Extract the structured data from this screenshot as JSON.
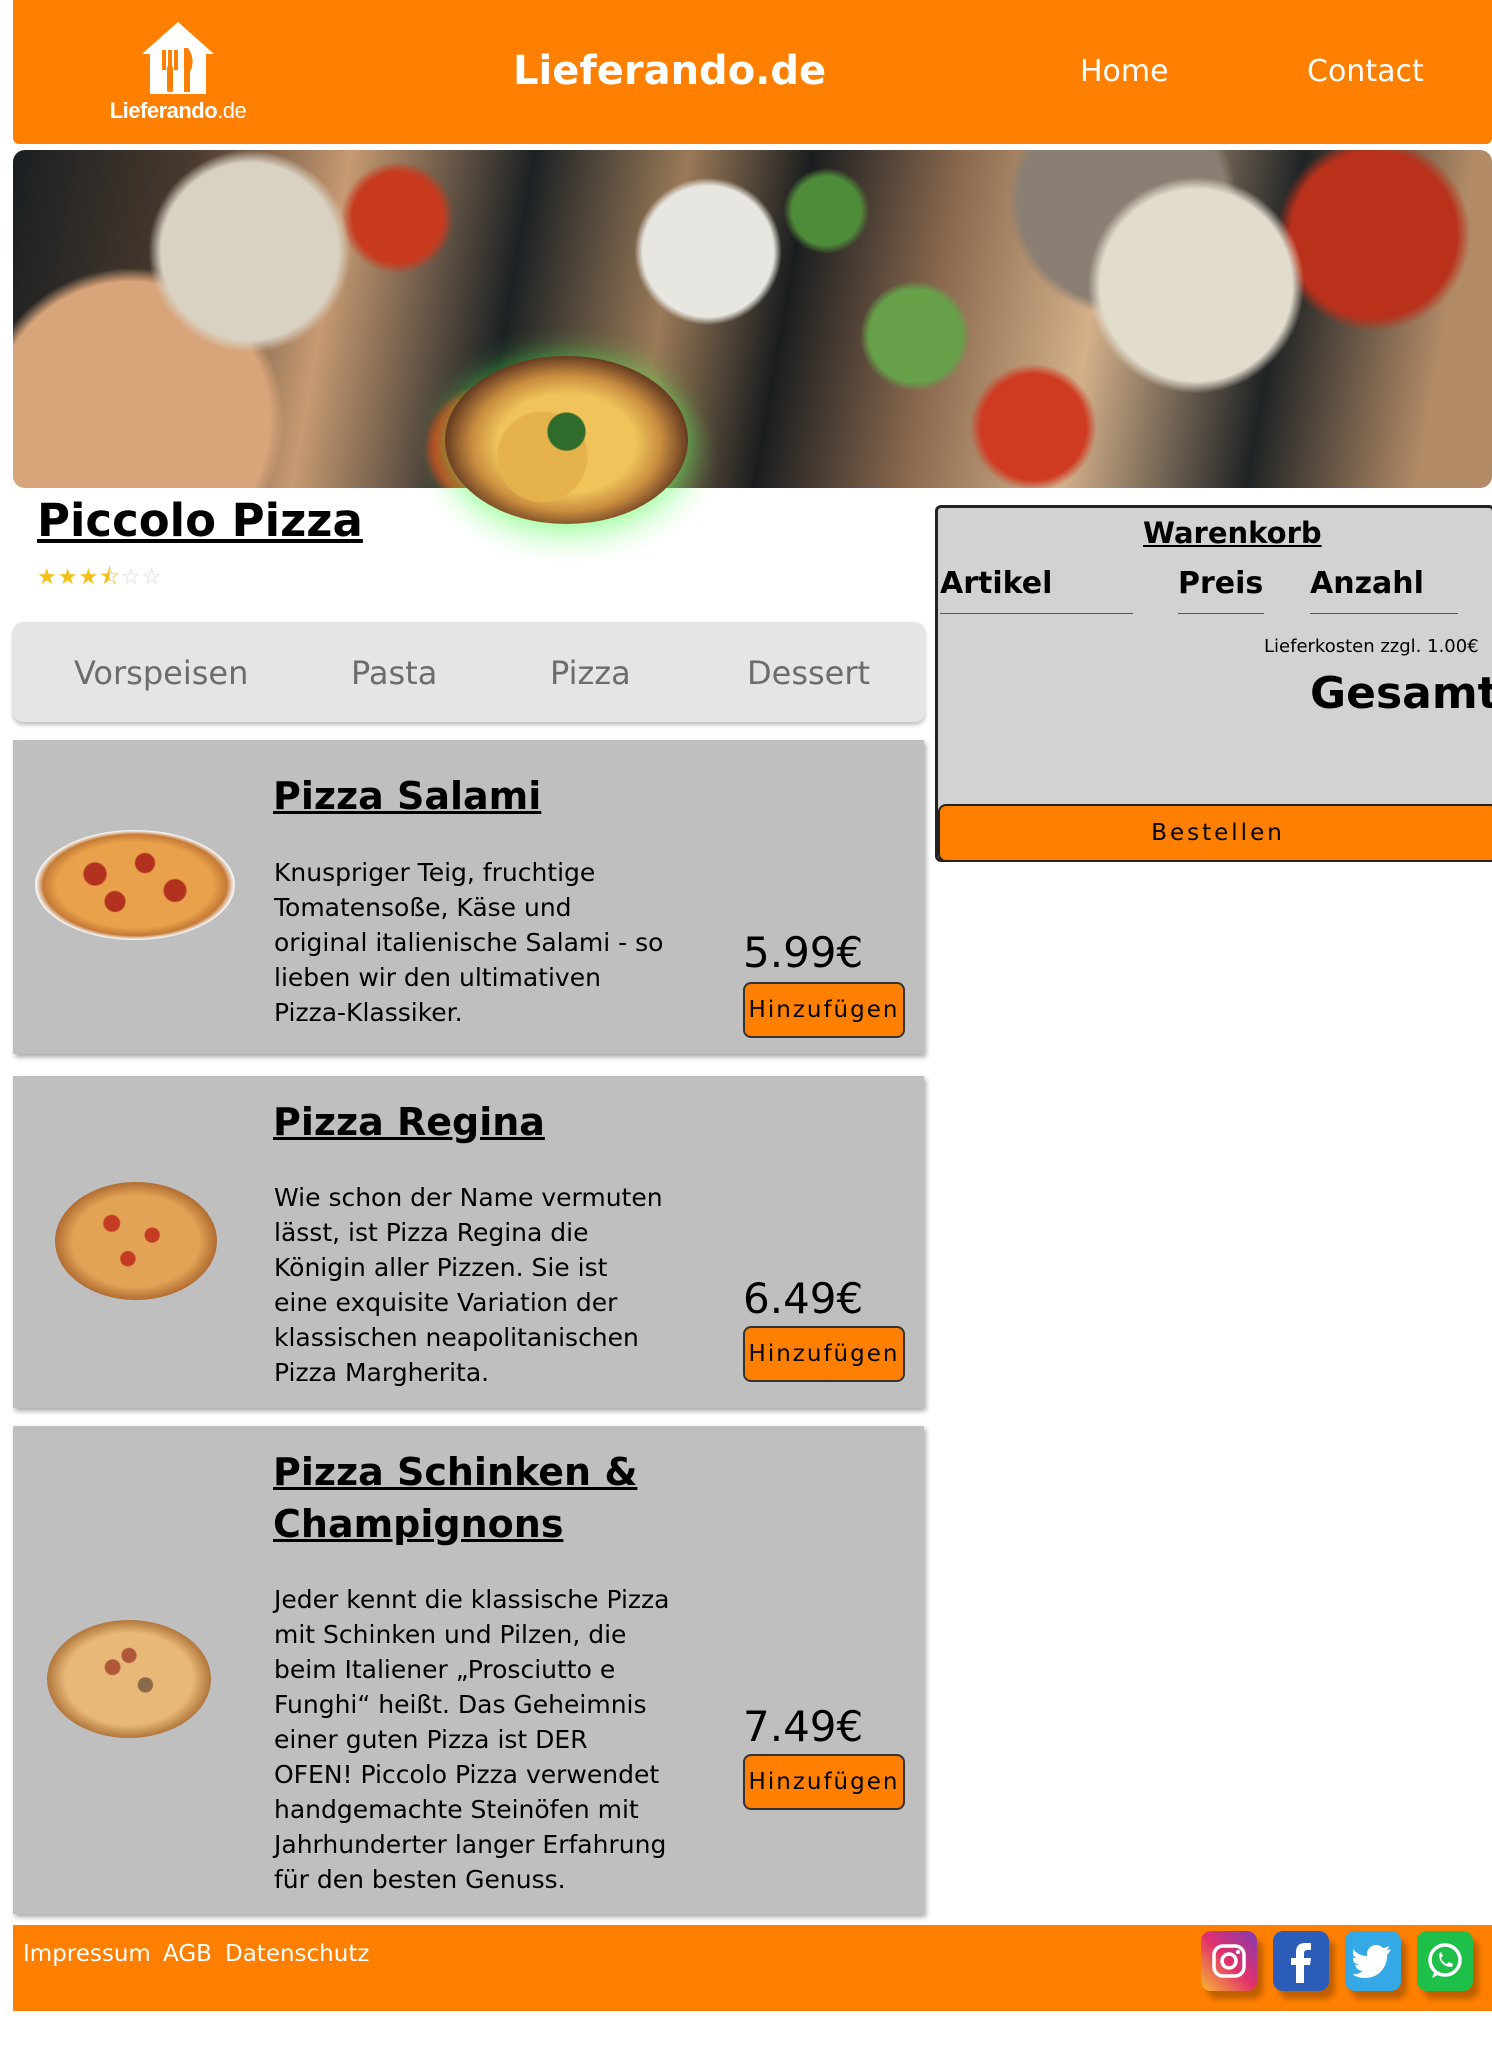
{
  "header": {
    "logo_text_bold": "Lieferando",
    "logo_text_thin": ".de",
    "site_title": "Lieferando.de",
    "nav": {
      "home": "Home",
      "contact": "Contact"
    }
  },
  "restaurant": {
    "name": "Piccolo Pizza",
    "rating": 3.5,
    "rating_max": 5,
    "stars_display": {
      "filled": "★★★",
      "half": "⯪",
      "empty": "☆☆"
    }
  },
  "categories": [
    "Vorspeisen",
    "Pasta",
    "Pizza",
    "Dessert"
  ],
  "menu": [
    {
      "title": "Pizza Salami",
      "description": "Knuspriger Teig, fruchtige Tomatensoße, Käse und original italienische Salami - so lieben wir den ultimativen Pizza-Klassiker.",
      "price": "5.99€",
      "button": "Hinzufügen"
    },
    {
      "title": "Pizza Regina",
      "description": "Wie schon der Name vermuten lässt, ist Pizza Regina die Königin aller Pizzen. Sie ist eine exquisite Variation der klassischen neapolitanischen Pizza Margherita.",
      "price": "6.49€",
      "button": "Hinzufügen"
    },
    {
      "title": "Pizza Schinken & Champignons",
      "description": "Jeder kennt die klassische Pizza mit Schinken und Pilzen, die beim Italiener „Prosciutto e Funghi“ heißt. Das Geheimnis einer guten Pizza ist DER OFEN! Piccolo Pizza verwendet handgemachte Steinöfen mit Jahrhunderter langer Erfahrung für den besten Genuss.",
      "price": "7.49€",
      "button": "Hinzufügen"
    }
  ],
  "cart": {
    "title": "Warenkorb",
    "columns": [
      "Artikel",
      "Preis",
      "Anzahl"
    ],
    "delivery_fee": "Lieferkosten zzgl. 1.00€",
    "total_label": "Gesamt",
    "order_button": "Bestellen"
  },
  "footer": {
    "links": [
      "Impressum",
      "AGB",
      "Datenschutz"
    ],
    "social": [
      "instagram-icon",
      "facebook-icon",
      "twitter-icon",
      "whatsapp-icon"
    ]
  },
  "colors": {
    "brand_orange": "#ff7f00",
    "card_gray": "#bfbfbf",
    "tab_gray": "#e5e5e5",
    "cart_gray": "#d2d2d2",
    "star_gold": "#f2c018"
  }
}
